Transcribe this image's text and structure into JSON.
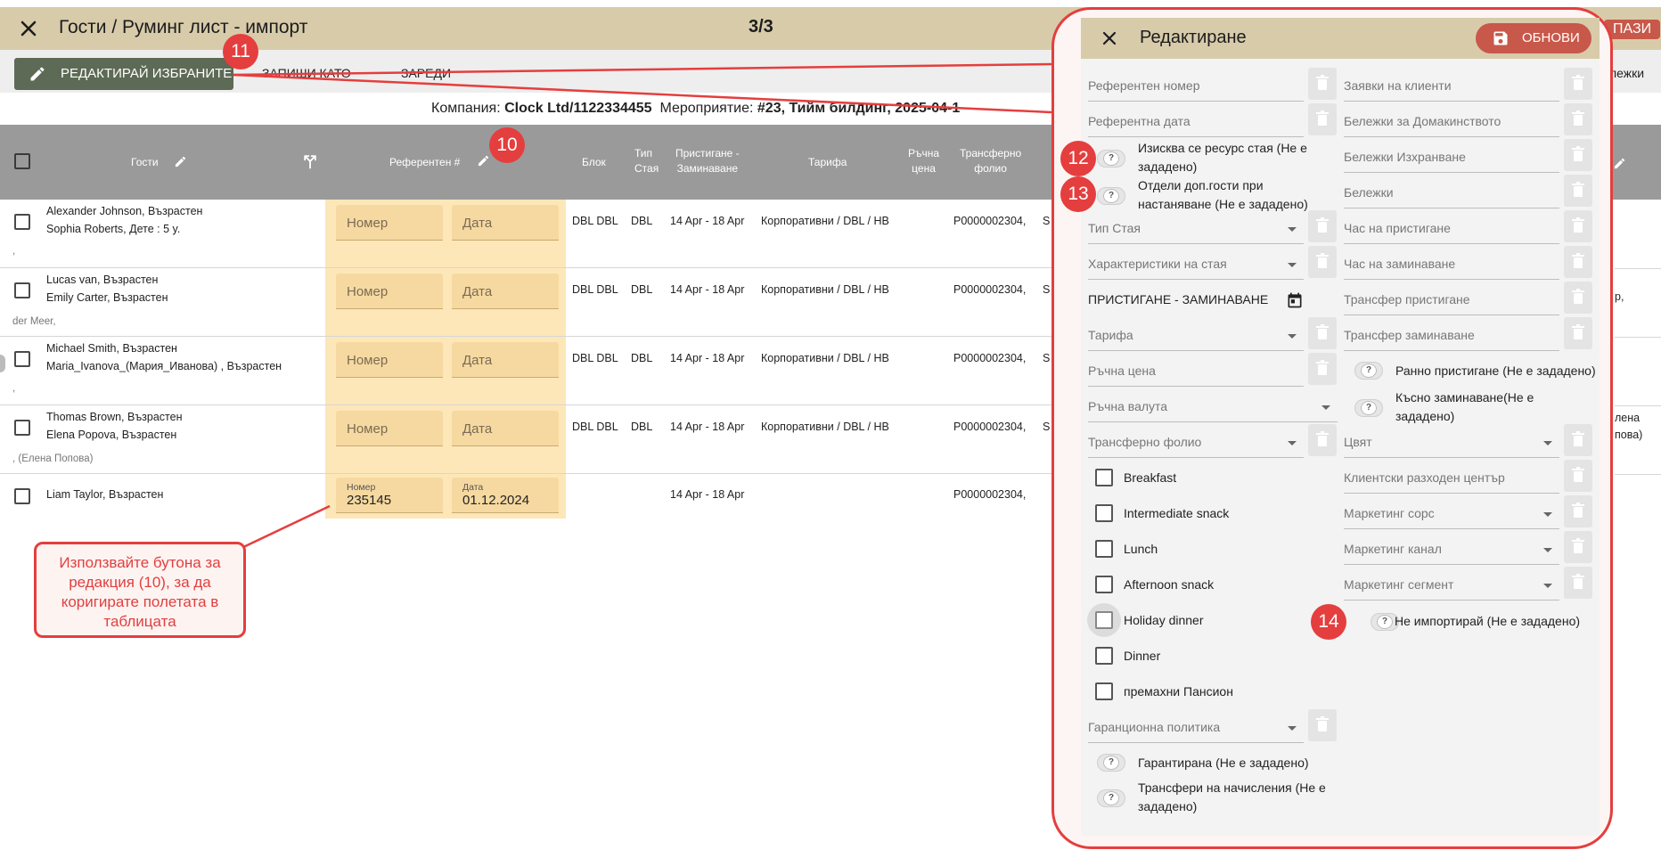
{
  "topbar": {
    "title": "Гости / Руминг лист - импорт",
    "page": "3/3",
    "right_btn": "ПАЗИ"
  },
  "toolbar": {
    "edit_selected": "РЕДАКТИРАЙ ИЗБРАНИТЕ",
    "save_as": "ЗАПИШИ КАТО",
    "load": "ЗАРЕДИ",
    "notes": "лежки"
  },
  "info": {
    "company_label": "Компания:",
    "company": "Clock Ltd/1122334455",
    "event_label": "Мероприятие:",
    "event": "#23, Тийм билдинг, 2025-04-1"
  },
  "table": {
    "headers": {
      "guests": "Гости",
      "ref": "Референтен #",
      "block": "Блок",
      "room_type_1": "Тип",
      "room_type_2": "Стая",
      "arrival_1": "Пристигане -",
      "arrival_2": "Заминаване",
      "rate": "Тарифа",
      "manual_1": "Ръчна",
      "manual_2": "цена",
      "folio_1": "Трансферно",
      "folio_2": "фолио"
    },
    "rows": [
      {
        "guest1": "Alexander Johnson, Възрастен",
        "guest2": "Sophia Roberts, Дете : 5 y.",
        "extra": ",",
        "num": "Номер",
        "date": "Дата",
        "block": "DBL DBL",
        "type": "DBL",
        "dates": "14 Apr - 18 Apr",
        "rate": "Корпоративни / DBL / HB",
        "folio": "P0000002304,",
        "s": "S"
      },
      {
        "guest1": "Lucas van, Възрастен",
        "guest2": "Emily Carter, Възрастен",
        "extra": "der Meer,",
        "num": "Номер",
        "date": "Дата",
        "block": "DBL DBL",
        "type": "DBL",
        "dates": "14 Apr - 18 Apr",
        "rate": "Корпоративни / DBL / HB",
        "folio": "P0000002304,",
        "s": "S"
      },
      {
        "guest1": "Michael Smith, Възрастен",
        "guest2": "Maria_Ivanova_(Мария_Иванова) , Възрастен",
        "extra": ",",
        "num": "Номер",
        "date": "Дата",
        "block": "DBL DBL",
        "type": "DBL",
        "dates": "14 Apr - 18 Apr",
        "rate": "Корпоративни / DBL / HB",
        "folio": "P0000002304,",
        "s": "S"
      },
      {
        "guest1": "Thomas Brown, Възрастен",
        "guest2": "Elena Popova, Възрастен",
        "extra": ", (Елена Попова)",
        "num": "Номер",
        "date": "Дата",
        "block": "DBL DBL",
        "type": "DBL",
        "dates": "14 Apr - 18 Apr",
        "rate": "Корпоративни / DBL / HB",
        "folio": "P0000002304,",
        "s": "S"
      },
      {
        "guest1": "Liam Taylor, Възрастен",
        "guest2": "",
        "extra": "",
        "num_label": "Номер",
        "num_value": "235145",
        "date_label": "Дата",
        "date_value": "01.12.2024",
        "block": "",
        "type": "",
        "dates": "14 Apr - 18 Apr",
        "rate": "",
        "folio": "P0000002304,",
        "s": ""
      }
    ],
    "right_edge": {
      "r1": "р,",
      "r3a": "лена",
      "r3b": "пова)"
    }
  },
  "callout": {
    "text": "Използвайте бутона за редакция (10), за да коригирате полетата в таблицата"
  },
  "badges": {
    "b10": "10",
    "b11": "11",
    "b12": "12",
    "b13": "13",
    "b14": "14"
  },
  "panel": {
    "title": "Редактиране",
    "refresh": "ОБНОВИ",
    "left": {
      "ref_num": "Референтен номер",
      "ref_date": "Референтна дата",
      "room_resource": "Изисква се ресурс стая (Не е зададено)",
      "separate_guests": "Отдели доп.гости при настаняване (Не е зададено)",
      "room_type": "Тип Стая",
      "room_features": "Характеристики на стая",
      "arrival_departure": "ПРИСТИГАНЕ - ЗАМИНАВАНЕ",
      "rate": "Тарифа",
      "manual_price": "Ръчна цена",
      "manual_currency": "Ръчна валута",
      "transfer_folio": "Трансферно фолио",
      "meals": [
        "Breakfast",
        "Intermediate snack",
        "Lunch",
        "Afternoon snack",
        "Holiday dinner",
        "Dinner",
        "премахни Пансион"
      ],
      "guarantee_policy": "Гаранционна политика",
      "guaranteed": "Гарантирана (Не е зададено)",
      "charge_transfers": "Трансфери на начисления (Не е зададено)"
    },
    "right": {
      "client_requests": "Заявки на клиенти",
      "housekeeping_notes": "Бележки за Домакинството",
      "food_notes": "Бележки Изхранване",
      "notes": "Бележки",
      "arrival_time": "Час на пристигане",
      "departure_time": "Час на заминаване",
      "arrival_transfer": "Трансфер пристигане",
      "departure_transfer": "Трансфер заминаване",
      "early_arrival": "Ранно пристигане (Не е зададено)",
      "late_departure": "Късно заминаване(Не е зададено)",
      "color": "Цвят",
      "cost_center": "Клиентски разходен център",
      "marketing_source": "Маркетинг сорс",
      "marketing_channel": "Маркетинг канал",
      "marketing_segment": "Маркетинг сегмент",
      "do_not_import": "Не импортирай (Не е зададено)"
    },
    "toggle_glyph": "?"
  },
  "colors": {
    "header_bar": "#d8cbaa",
    "edit_button": "#5d6a55",
    "accent_red": "#e53e3e",
    "refresh_button": "#c8584a",
    "table_header": "#9a9a9a",
    "ref_highlight": "#fde7b8"
  }
}
